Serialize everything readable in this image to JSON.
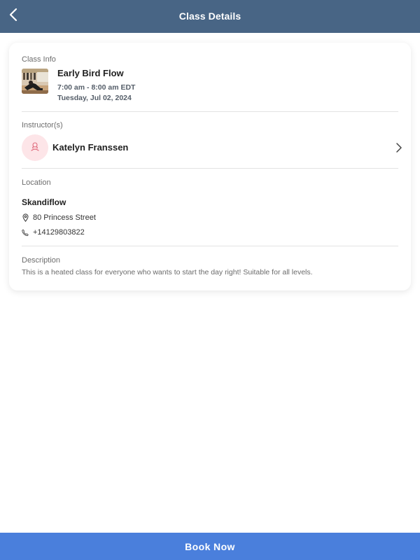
{
  "header": {
    "title": "Class Details",
    "back_icon": "chevron-left-icon",
    "background": "#486585"
  },
  "class_info": {
    "label": "Class Info",
    "name": "Early Bird Flow",
    "time": "7:00 am - 8:00 am EDT",
    "date": "Tuesday, Jul 02, 2024",
    "thumbnail": "yoga-class-thumbnail"
  },
  "instructor": {
    "label": "Instructor(s)",
    "name": "Katelyn Franssen",
    "avatar_icon": "user-icon",
    "avatar_bg": "#fde5e8",
    "chevron_icon": "chevron-right-icon"
  },
  "location": {
    "label": "Location",
    "name": "Skandiflow",
    "address": "80 Princess Street",
    "address_icon": "map-pin-icon",
    "phone": "+14129803822",
    "phone_icon": "phone-icon"
  },
  "description": {
    "label": "Description",
    "text": "This is a heated class for everyone who wants to start the day right! Suitable for all levels."
  },
  "footer": {
    "book_label": "Book Now",
    "accent": "#4a7fdc"
  }
}
